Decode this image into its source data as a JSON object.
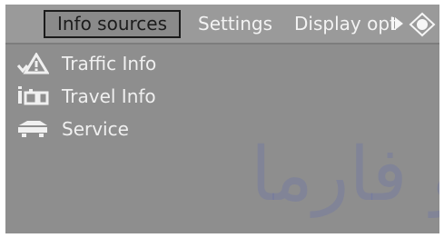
{
  "tabs": {
    "active_label": "Info sources",
    "settings_label": "Settings",
    "display_label": "Display options"
  },
  "icons": {
    "scroll_right": "play-arrow-icon",
    "navigation": "navigation-diamond-icon"
  },
  "menu": {
    "items": [
      {
        "label": "Traffic Info",
        "icon": "traffic-warning-icon"
      },
      {
        "label": "Travel Info",
        "icon": "travel-info-icon"
      },
      {
        "label": "Service",
        "icon": "service-car-icon"
      }
    ]
  },
  "watermark": {
    "text": "و فارما"
  },
  "colors": {
    "screen_bg": "#8e8e8e",
    "active_tab_border": "#1b1b1b",
    "label_text": "#f0f0f0"
  }
}
